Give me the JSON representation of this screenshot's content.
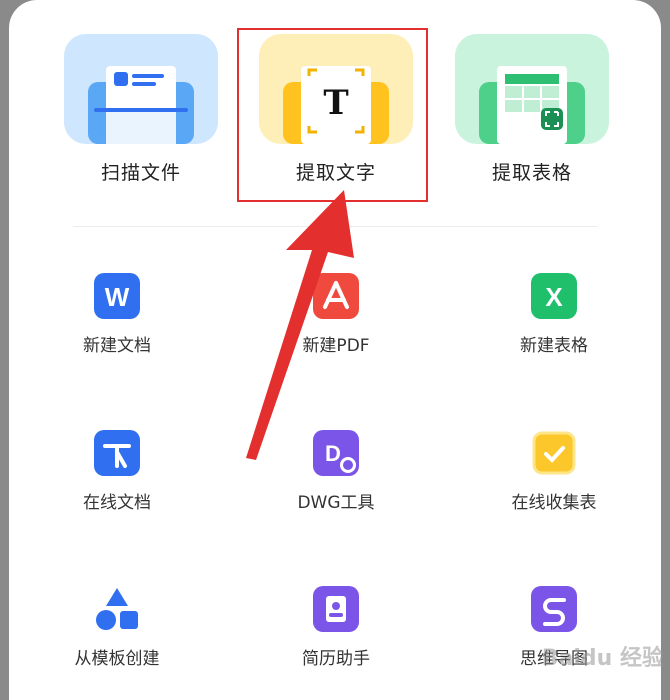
{
  "top_tools": [
    {
      "label": "扫描文件",
      "icon": "scan-document-icon",
      "color": "#cfe6ff"
    },
    {
      "label": "提取文字",
      "icon": "extract-text-icon",
      "glyph": "T",
      "color": "#fdefb7"
    },
    {
      "label": "提取表格",
      "icon": "extract-table-icon",
      "color": "#c9f3dd"
    }
  ],
  "grid": [
    {
      "label": "新建文档",
      "icon": "word-icon",
      "glyph": "W",
      "color": "#2f6ff0"
    },
    {
      "label": "新建PDF",
      "icon": "pdf-icon",
      "color": "#f04a3e"
    },
    {
      "label": "新建表格",
      "icon": "excel-icon",
      "glyph": "X",
      "color": "#1fbf6b"
    },
    {
      "label": "在线文档",
      "icon": "online-doc-icon",
      "color": "#2f6ff0"
    },
    {
      "label": "DWG工具",
      "icon": "dwg-icon",
      "glyph": "D",
      "color": "#7b55e8"
    },
    {
      "label": "在线收集表",
      "icon": "form-collect-icon",
      "color": "#fbc72a"
    },
    {
      "label": "从模板创建",
      "icon": "template-shapes-icon",
      "color": "#2f6ff0"
    },
    {
      "label": "简历助手",
      "icon": "resume-icon",
      "color": "#7b55e8"
    },
    {
      "label": "思维导图",
      "icon": "mindmap-icon",
      "color": "#7b55e8"
    }
  ],
  "watermark": "Baidu 经验",
  "colors": {
    "accent_red": "#e3302f"
  }
}
